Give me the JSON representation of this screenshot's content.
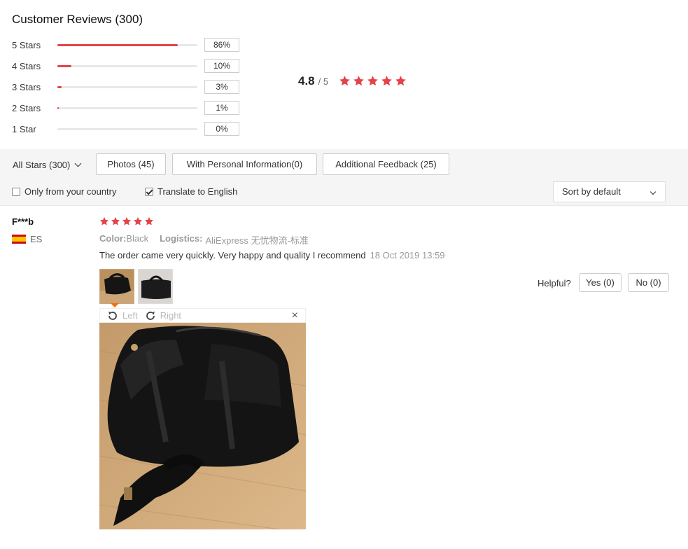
{
  "title": "Customer Reviews (300)",
  "distribution": [
    {
      "label": "5 Stars",
      "percent": "86%",
      "fraction": 0.86
    },
    {
      "label": "4 Stars",
      "percent": "10%",
      "fraction": 0.1
    },
    {
      "label": "3 Stars",
      "percent": "3%",
      "fraction": 0.03
    },
    {
      "label": "2 Stars",
      "percent": "1%",
      "fraction": 0.01
    },
    {
      "label": "1 Star",
      "percent": "0%",
      "fraction": 0.0
    }
  ],
  "rating": {
    "value": "4.8",
    "out_of": "/ 5",
    "stars": 5,
    "star_color": "#e5434a"
  },
  "filters": {
    "all_stars": "All Stars (300)",
    "photos": "Photos (45)",
    "personal_info": "With Personal Information(0)",
    "additional": "Additional Feedback (25)",
    "only_country": "Only from your country",
    "only_country_checked": false,
    "translate": "Translate to English",
    "translate_checked": true,
    "sort": "Sort by default"
  },
  "review": {
    "name": "F***b",
    "country": "ES",
    "stars": 5,
    "color_label": "Color:",
    "color_value": "Black",
    "logistics_label": "Logistics:",
    "logistics_value": "AliExpress 无忧物流-标准",
    "text": "The order came very quickly. Very happy and quality I recommend",
    "date": "18 Oct 2019 13:59",
    "helpful_label": "Helpful?",
    "yes_label": "Yes (0)",
    "no_label": "No (0)",
    "rotate_left": "Left",
    "rotate_right": "Right",
    "close_glyph": "×"
  }
}
